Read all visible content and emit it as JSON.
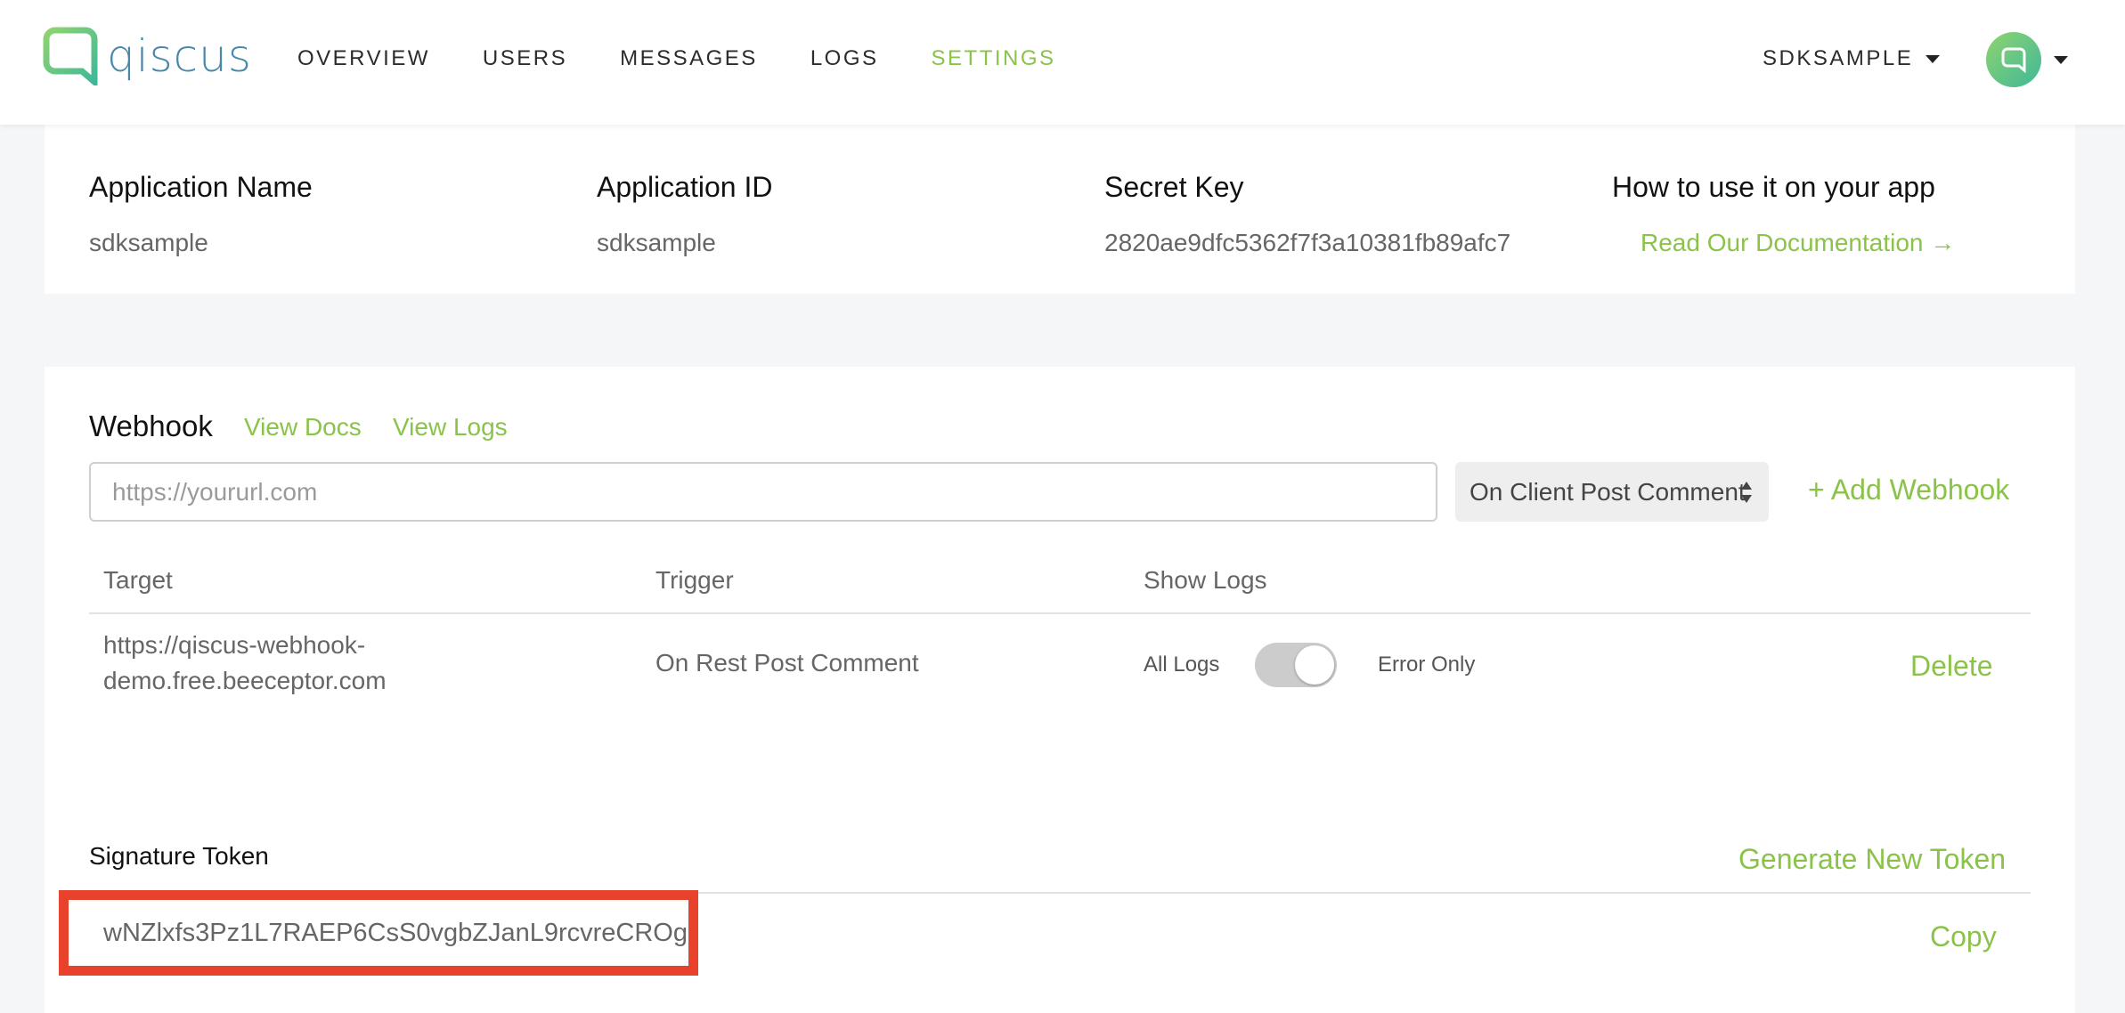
{
  "brand": {
    "name": "qiscus",
    "accent_color": "#8bc34a",
    "logo_color": "#4a88a8",
    "highlight_color": "#e8412c"
  },
  "nav": {
    "items": [
      {
        "label": "OVERVIEW",
        "active": false
      },
      {
        "label": "USERS",
        "active": false
      },
      {
        "label": "MESSAGES",
        "active": false
      },
      {
        "label": "LOGS",
        "active": false
      },
      {
        "label": "SETTINGS",
        "active": true
      }
    ],
    "app_switcher": "SDKSAMPLE",
    "avatar_icon": "chat-bubble-icon"
  },
  "app_info": {
    "name_label": "Application Name",
    "name_value": "sdksample",
    "id_label": "Application ID",
    "id_value": "sdksample",
    "secret_label": "Secret Key",
    "secret_value": "2820ae9dfc5362f7f3a10381fb89afc7",
    "howto_label": "How to use it on your app",
    "docs_link": "Read Our Documentation →"
  },
  "webhook": {
    "title": "Webhook",
    "view_docs": "View Docs",
    "view_logs": "View Logs",
    "url_placeholder": "https://yoururl.com",
    "trigger_selected": "On Client Post Comment",
    "add_label": "+ Add Webhook",
    "columns": [
      "Target",
      "Trigger",
      "Show Logs"
    ],
    "rows": [
      {
        "target_line1": "https://qiscus-webhook-",
        "target_line2": "demo.free.beeceptor.com",
        "trigger": "On Rest Post Comment",
        "logs_left": "All Logs",
        "logs_right": "Error Only",
        "toggle_on": true,
        "delete_label": "Delete"
      }
    ]
  },
  "signature": {
    "label": "Signature Token",
    "generate_label": "Generate New Token",
    "token": "wNZlxfs3Pz1L7RAEP6CsS0vgbZJanL9rcvreCROg",
    "copy_label": "Copy"
  }
}
